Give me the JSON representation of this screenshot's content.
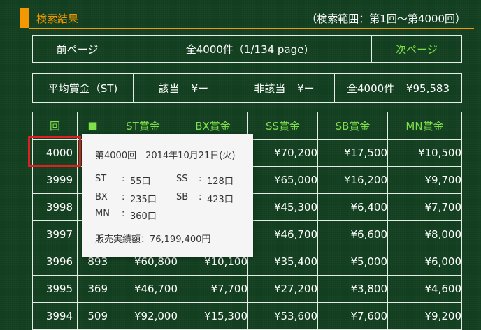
{
  "header": {
    "title": "検索結果",
    "range": "（検索範囲：第1回〜第4000回）"
  },
  "pager": {
    "prev_label": "前ページ",
    "summary": "全4000件（1/134 page)",
    "next_label": "次ページ"
  },
  "averages": {
    "label": "平均賞金（ST)",
    "match_label": "該当",
    "match_value": "¥ー",
    "nonmatch_label": "非該当",
    "nonmatch_value": "¥ー",
    "all_label": "全4000件",
    "all_value": "¥95,583"
  },
  "table": {
    "headers": [
      "回",
      "■",
      "ST賞金",
      "BX賞金",
      "SS賞金",
      "SB賞金",
      "MN賞金"
    ],
    "rows": [
      [
        "4000",
        "",
        "",
        "",
        "¥70,200",
        "¥17,500",
        "¥10,500"
      ],
      [
        "3999",
        "",
        "",
        "",
        "¥65,000",
        "¥16,200",
        "¥9,700"
      ],
      [
        "3998",
        "",
        "",
        "",
        "¥45,300",
        "¥6,400",
        "¥7,700"
      ],
      [
        "3997",
        "",
        "",
        "",
        "¥46,700",
        "¥6,600",
        "¥8,000"
      ],
      [
        "3996",
        "893",
        "¥60,800",
        "¥10,100",
        "¥35,400",
        "¥5,000",
        "¥6,000"
      ],
      [
        "3995",
        "369",
        "¥46,700",
        "¥7,700",
        "¥27,200",
        "¥3,800",
        "¥4,600"
      ],
      [
        "3994",
        "509",
        "¥92,000",
        "¥15,300",
        "¥53,600",
        "¥7,600",
        "¥9,200"
      ]
    ]
  },
  "tooltip": {
    "title": "第4000回　2014年10月21日(火)",
    "st_label": "ST",
    "st_value": "55口",
    "ss_label": "SS",
    "ss_value": "128口",
    "bx_label": "BX",
    "bx_value": "235口",
    "sb_label": "SB",
    "sb_value": "423口",
    "mn_label": "MN",
    "mn_value": "360口",
    "sales": "販売実績額：76,199,400円"
  }
}
